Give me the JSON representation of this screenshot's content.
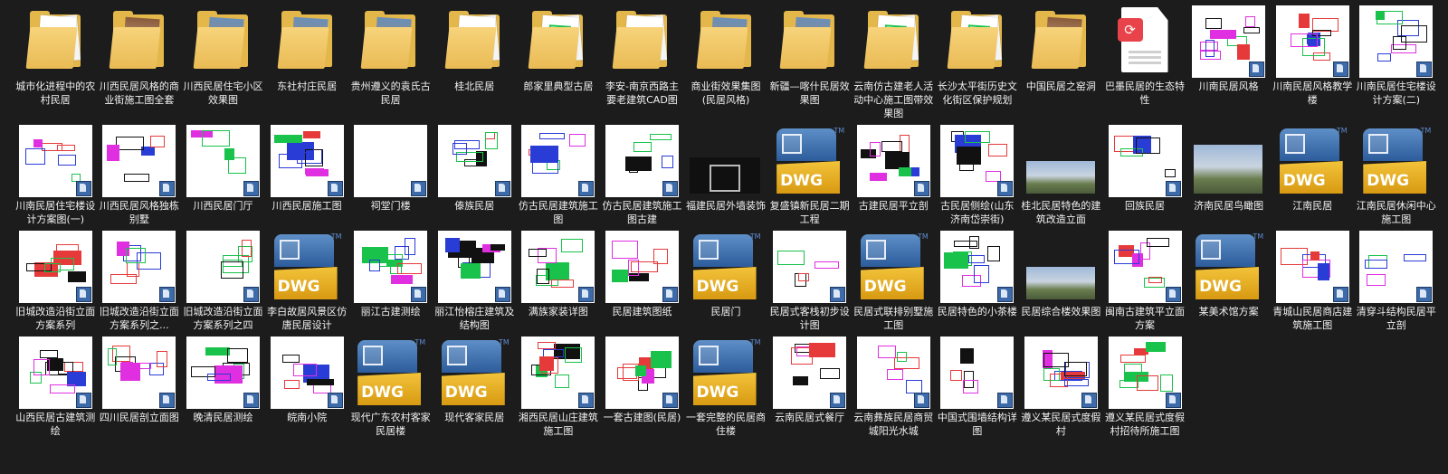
{
  "colors": {
    "background": "#1c1c1c",
    "folder": "#e4b74a",
    "cad_green": "#19c24b",
    "cad_magenta": "#e02fe0",
    "cad_blue": "#2a3cd6",
    "dwg_blue": "#3d6fb0",
    "dwg_yellow": "#f0b82a",
    "pdf_red": "#e8424a"
  },
  "items": [
    {
      "label": "城市化进程中的农村民居",
      "kind": "folder",
      "icon": "folder-icon"
    },
    {
      "label": "川西民居风格的商业街施工图全套",
      "kind": "folder-photo",
      "icon": "folder-icon"
    },
    {
      "label": "川西民居住宅小区效果图",
      "kind": "folder-photo",
      "icon": "folder-icon"
    },
    {
      "label": "东社村庄民居",
      "kind": "folder-photo",
      "icon": "folder-icon"
    },
    {
      "label": "贵州遵义的袁氏古民居",
      "kind": "folder-photo",
      "icon": "folder-icon"
    },
    {
      "label": "桂北民居",
      "kind": "folder",
      "icon": "folder-icon"
    },
    {
      "label": "郎家里典型古居",
      "kind": "folder-doc",
      "icon": "folder-icon"
    },
    {
      "label": "李安-南京西路主要老建筑CAD图",
      "kind": "folder",
      "icon": "folder-icon"
    },
    {
      "label": "商业街效果集图(民居风格)",
      "kind": "folder-photo",
      "icon": "folder-icon"
    },
    {
      "label": "新疆—喀什民居效果图",
      "kind": "folder-photo",
      "icon": "folder-icon"
    },
    {
      "label": "云南仿古建老人活动中心施工图带效果图",
      "kind": "folder-doc",
      "icon": "folder-icon"
    },
    {
      "label": "长沙太平街历史文化街区保护规划",
      "kind": "folder-doc",
      "icon": "folder-icon"
    },
    {
      "label": "中国民居之窑洞",
      "kind": "folder-photo",
      "icon": "folder-icon"
    },
    {
      "label": "巴墨民居的生态特性",
      "kind": "pdf",
      "icon": "pdf-file-icon"
    },
    {
      "label": "川南民居风格",
      "kind": "cad",
      "icon": "cad-thumbnail"
    },
    {
      "label": "川南民居风格教学楼",
      "kind": "cad",
      "icon": "cad-thumbnail"
    },
    {
      "label": "川南民居住宅楼设计方案(二)",
      "kind": "cad",
      "icon": "cad-thumbnail"
    },
    {
      "label": "川南民居住宅楼设计方案图(一)",
      "kind": "cad",
      "icon": "cad-thumbnail"
    },
    {
      "label": "川西民居风格独栋别墅",
      "kind": "cad",
      "icon": "cad-thumbnail"
    },
    {
      "label": "川西民居门厅",
      "kind": "cad",
      "icon": "cad-thumbnail"
    },
    {
      "label": "川西民居施工图",
      "kind": "cad",
      "icon": "cad-thumbnail"
    },
    {
      "label": "祠堂门楼",
      "kind": "blank",
      "icon": "cad-thumbnail"
    },
    {
      "label": "傣族民居",
      "kind": "cad",
      "icon": "cad-thumbnail"
    },
    {
      "label": "仿古民居建筑施工图",
      "kind": "cad",
      "icon": "cad-thumbnail"
    },
    {
      "label": "仿古民居建筑施工图古建",
      "kind": "cad",
      "icon": "cad-thumbnail"
    },
    {
      "label": "福建民居外墙装饰",
      "kind": "dark",
      "icon": "image-thumbnail"
    },
    {
      "label": "复盛镇新民居二期工程",
      "kind": "dwg",
      "icon": "dwg-file-icon"
    },
    {
      "label": "古建民居平立剖",
      "kind": "cad",
      "icon": "cad-thumbnail"
    },
    {
      "label": "古民居侧绘(山东济南岱崇街)",
      "kind": "cad",
      "icon": "cad-thumbnail"
    },
    {
      "label": "桂北民居特色的建筑改造立面",
      "kind": "photo",
      "icon": "image-thumbnail"
    },
    {
      "label": "回族民居",
      "kind": "cad",
      "icon": "cad-thumbnail"
    },
    {
      "label": "济南民居鸟瞰图",
      "kind": "photo",
      "icon": "image-thumbnail"
    },
    {
      "label": "江南民居",
      "kind": "dwg",
      "icon": "dwg-file-icon"
    },
    {
      "label": "江南民居休闲中心施工图",
      "kind": "dwg",
      "icon": "dwg-file-icon"
    },
    {
      "label": "旧城改造沿街立面方案系列",
      "kind": "cad",
      "icon": "cad-thumbnail"
    },
    {
      "label": "旧城改造沿街立面方案系列之...",
      "kind": "cad",
      "icon": "cad-thumbnail"
    },
    {
      "label": "旧城改造沿街立面方案系列之四",
      "kind": "cad",
      "icon": "cad-thumbnail"
    },
    {
      "label": "李白故居风景区仿唐民居设计",
      "kind": "dwg",
      "icon": "dwg-file-icon"
    },
    {
      "label": "丽江古建测绘",
      "kind": "cad",
      "icon": "cad-thumbnail"
    },
    {
      "label": "丽江怡榕庄建筑及结构图",
      "kind": "cad",
      "icon": "cad-thumbnail"
    },
    {
      "label": "满族家装详图",
      "kind": "cad",
      "icon": "cad-thumbnail"
    },
    {
      "label": "民居建筑图纸",
      "kind": "cad",
      "icon": "cad-thumbnail"
    },
    {
      "label": "民居门",
      "kind": "dwg",
      "icon": "dwg-file-icon"
    },
    {
      "label": "民居式客栈初步设计图",
      "kind": "cad",
      "icon": "cad-thumbnail"
    },
    {
      "label": "民居式联排别墅施工图",
      "kind": "dwg",
      "icon": "dwg-file-icon"
    },
    {
      "label": "民居特色的小茶楼",
      "kind": "cad",
      "icon": "cad-thumbnail"
    },
    {
      "label": "民居综合楼效果图",
      "kind": "photo",
      "icon": "image-thumbnail"
    },
    {
      "label": "闽南古建筑平立面方案",
      "kind": "cad",
      "icon": "cad-thumbnail"
    },
    {
      "label": "某美术馆方案",
      "kind": "dwg",
      "icon": "dwg-file-icon"
    },
    {
      "label": "青城山民居商店建筑施工图",
      "kind": "cad",
      "icon": "cad-thumbnail"
    },
    {
      "label": "清穿斗结构民居平立剖",
      "kind": "cad",
      "icon": "cad-thumbnail"
    },
    {
      "label": "山西民居古建筑测绘",
      "kind": "cad",
      "icon": "cad-thumbnail"
    },
    {
      "label": "四川民居剖立面图",
      "kind": "cad",
      "icon": "cad-thumbnail"
    },
    {
      "label": "晚清民居测绘",
      "kind": "cad",
      "icon": "cad-thumbnail"
    },
    {
      "label": "皖南小院",
      "kind": "cad",
      "icon": "cad-thumbnail"
    },
    {
      "label": "现代广东农村客家民居楼",
      "kind": "dwg",
      "icon": "dwg-file-icon"
    },
    {
      "label": "现代客家民居",
      "kind": "dwg",
      "icon": "dwg-file-icon"
    },
    {
      "label": "湘西民居山庄建筑施工图",
      "kind": "cad",
      "icon": "cad-thumbnail"
    },
    {
      "label": "一套古建图(民居)",
      "kind": "cad",
      "icon": "cad-thumbnail"
    },
    {
      "label": "一套完整的民居商住楼",
      "kind": "dwg",
      "icon": "dwg-file-icon"
    },
    {
      "label": "云南民居式餐厅",
      "kind": "cad",
      "icon": "cad-thumbnail"
    },
    {
      "label": "云南彝族民居商贸城阳光水城",
      "kind": "cad",
      "icon": "cad-thumbnail"
    },
    {
      "label": "中国式围墙结构详图",
      "kind": "cad",
      "icon": "cad-thumbnail"
    },
    {
      "label": "遵义某民居式度假村",
      "kind": "cad",
      "icon": "cad-thumbnail"
    },
    {
      "label": "遵义某民居式度假村招待所施工图",
      "kind": "cad",
      "icon": "cad-thumbnail"
    }
  ],
  "dwg_text": "DWG",
  "dwg_tm": "TM"
}
